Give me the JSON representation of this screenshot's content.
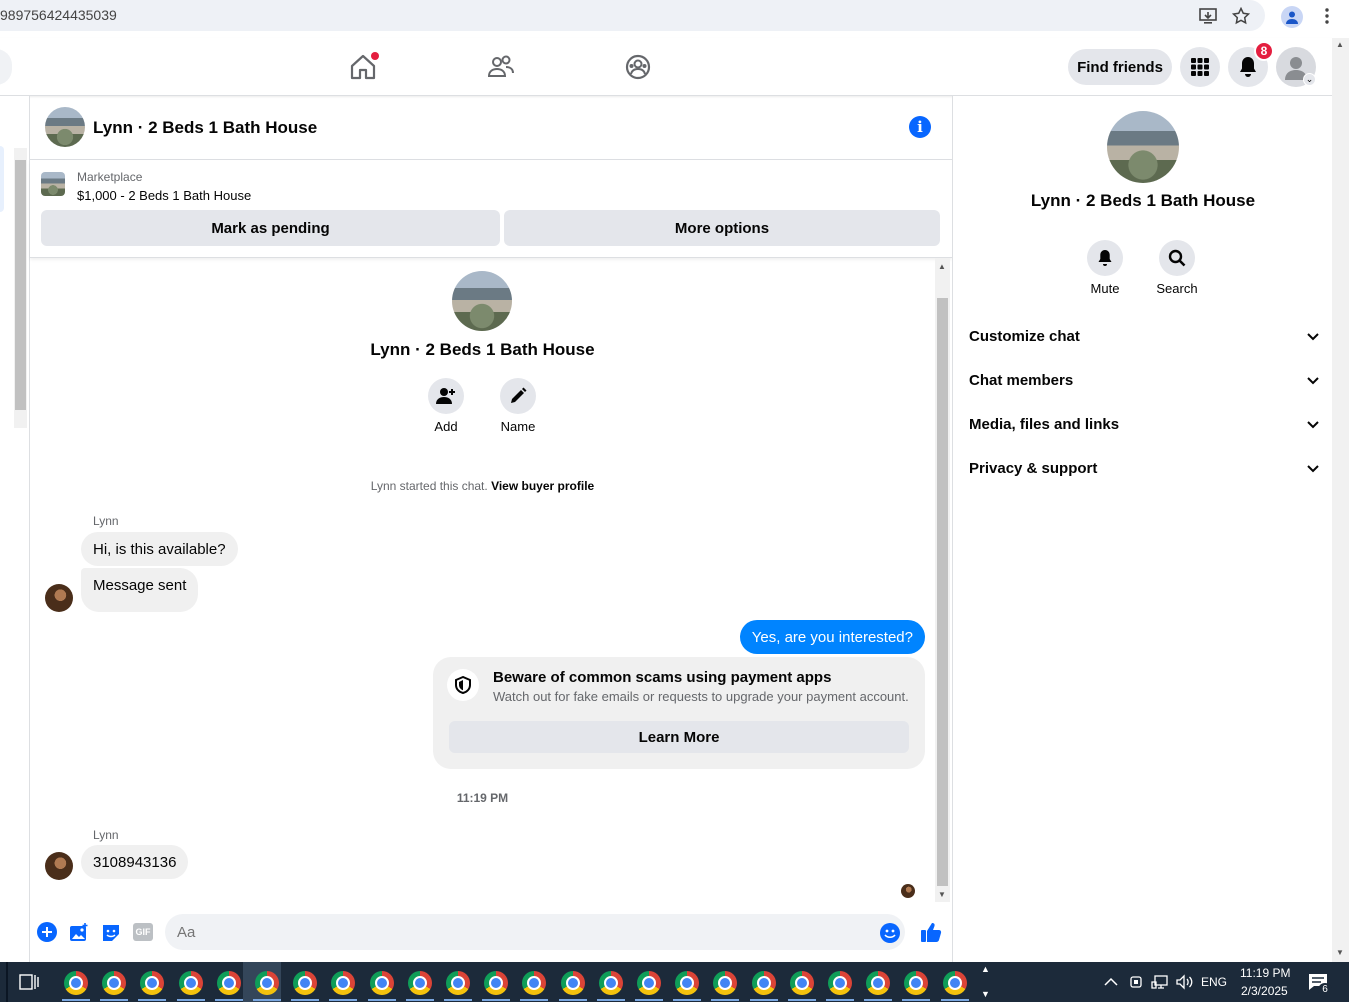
{
  "browser": {
    "url_fragment": "989756424435039"
  },
  "nav": {
    "find_friends": "Find friends",
    "notification_count": "8"
  },
  "chat": {
    "title": "Lynn · 2 Beds 1 Bath House",
    "marketplace_label": "Marketplace",
    "listing": "$1,000 - 2 Beds 1 Bath House",
    "mark_pending": "Mark as pending",
    "more_options": "More options",
    "profile_name": "Lynn · 2 Beds 1 Bath House",
    "add_label": "Add",
    "name_label": "Name",
    "started_text": "Lynn started this chat.",
    "view_buyer": "View buyer profile",
    "messages": [
      {
        "sender": "Lynn",
        "text": "Hi, is this available?"
      },
      {
        "text": "Message sent"
      },
      {
        "text": "Yes, are you interested?"
      },
      {
        "sender": "Lynn",
        "text": "3108943136"
      }
    ],
    "scam_title": "Beware of common scams using payment apps",
    "scam_sub": "Watch out for fake emails or requests to upgrade your payment account.",
    "learn_more": "Learn More",
    "timestamp": "11:19 PM",
    "input_placeholder": "Aa"
  },
  "right_panel": {
    "title": "Lynn · 2 Beds 1 Bath House",
    "mute": "Mute",
    "search": "Search",
    "sections": [
      "Customize chat",
      "Chat members",
      "Media, files and links",
      "Privacy & support"
    ]
  },
  "taskbar": {
    "lang": "ENG",
    "time": "11:19 PM",
    "date": "2/3/2025",
    "notif_count": "6"
  },
  "colors": {
    "accent": "#0866ff",
    "bubble_out": "#0084ff",
    "badge": "#e41e3f"
  }
}
